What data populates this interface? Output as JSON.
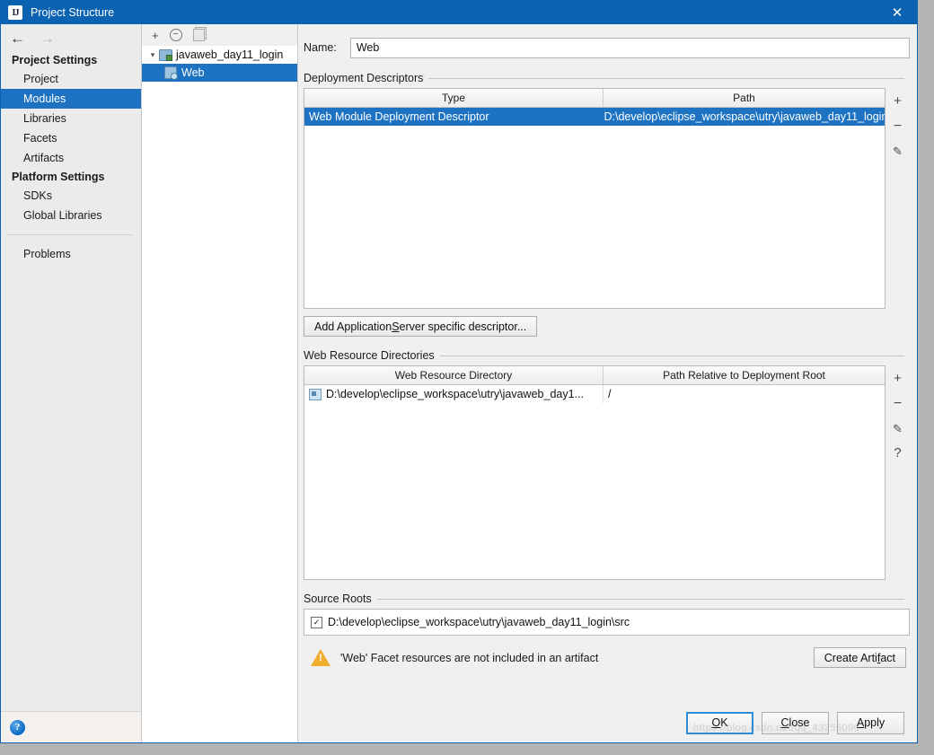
{
  "window": {
    "title": "Project Structure",
    "app_icon": "intellij-idea-icon",
    "close_label": "✕",
    "accent_color": "#0a62b0",
    "selection_color": "#1d72c2"
  },
  "sidebar": {
    "back_arrow": "←",
    "forward_arrow": "→",
    "groups": [
      {
        "label": "Project Settings",
        "items": [
          {
            "label": "Project",
            "selected": false
          },
          {
            "label": "Modules",
            "selected": true
          },
          {
            "label": "Libraries",
            "selected": false
          },
          {
            "label": "Facets",
            "selected": false
          },
          {
            "label": "Artifacts",
            "selected": false
          }
        ]
      },
      {
        "label": "Platform Settings",
        "items": [
          {
            "label": "SDKs",
            "selected": false
          },
          {
            "label": "Global Libraries",
            "selected": false
          }
        ]
      }
    ],
    "problems_label": "Problems",
    "help_icon": "help-circle-icon",
    "help_glyph": "?"
  },
  "tree": {
    "toolbar": {
      "add": "+",
      "remove": "−",
      "copy": "copy-icon"
    },
    "root": {
      "label": "javaweb_day11_login",
      "expanded": true,
      "chevron": "⌄"
    },
    "child": {
      "label": "Web",
      "selected": true
    }
  },
  "main": {
    "name": {
      "label": "Name:",
      "value": "Web"
    },
    "deployment_descriptors": {
      "title": "Deployment Descriptors",
      "columns": [
        "Type",
        "Path"
      ],
      "rows": [
        {
          "type": "Web Module Deployment Descriptor",
          "path": "D:\\develop\\eclipse_workspace\\utry\\javaweb_day11_login",
          "selected": true
        }
      ],
      "tools": [
        {
          "name": "add-descriptor-button",
          "glyph": "+"
        },
        {
          "name": "remove-descriptor-button",
          "glyph": "−"
        },
        {
          "name": "edit-descriptor-button",
          "glyph": "✎"
        }
      ],
      "add_button": {
        "prefix": "Add Application ",
        "accel": "S",
        "suffix": "erver specific descriptor..."
      }
    },
    "web_resource_directories": {
      "title": "Web Resource Directories",
      "columns": [
        "Web Resource Directory",
        "Path Relative to Deployment Root"
      ],
      "rows": [
        {
          "directory": "D:\\develop\\eclipse_workspace\\utry\\javaweb_day1...",
          "relative_path": "/",
          "icon": "folder-icon"
        }
      ],
      "tools": [
        {
          "name": "add-web-resource-button",
          "glyph": "+"
        },
        {
          "name": "remove-web-resource-button",
          "glyph": "−"
        },
        {
          "name": "edit-web-resource-button",
          "glyph": "✎"
        },
        {
          "name": "help-web-resource-button",
          "glyph": "?"
        }
      ]
    },
    "source_roots": {
      "title": "Source Roots",
      "rows": [
        {
          "checked": true,
          "check_glyph": "✓",
          "path": "D:\\develop\\eclipse_workspace\\utry\\javaweb_day11_login\\src"
        }
      ]
    },
    "warning": {
      "icon": "warning-triangle-icon",
      "text": "'Web' Facet resources are not included in an artifact",
      "action": {
        "prefix": "Create Arti",
        "accel": "f",
        "suffix": "act"
      }
    }
  },
  "footer": {
    "buttons": [
      {
        "name": "ok-button",
        "prefix": "",
        "accel": "O",
        "suffix": "K",
        "default": true
      },
      {
        "name": "close-button",
        "prefix": "",
        "accel": "C",
        "suffix": "lose",
        "default": false
      },
      {
        "name": "apply-button",
        "prefix": "",
        "accel": "A",
        "suffix": "pply",
        "default": false
      }
    ],
    "watermark": "https://blog.csdn.net/qq_43256090"
  }
}
